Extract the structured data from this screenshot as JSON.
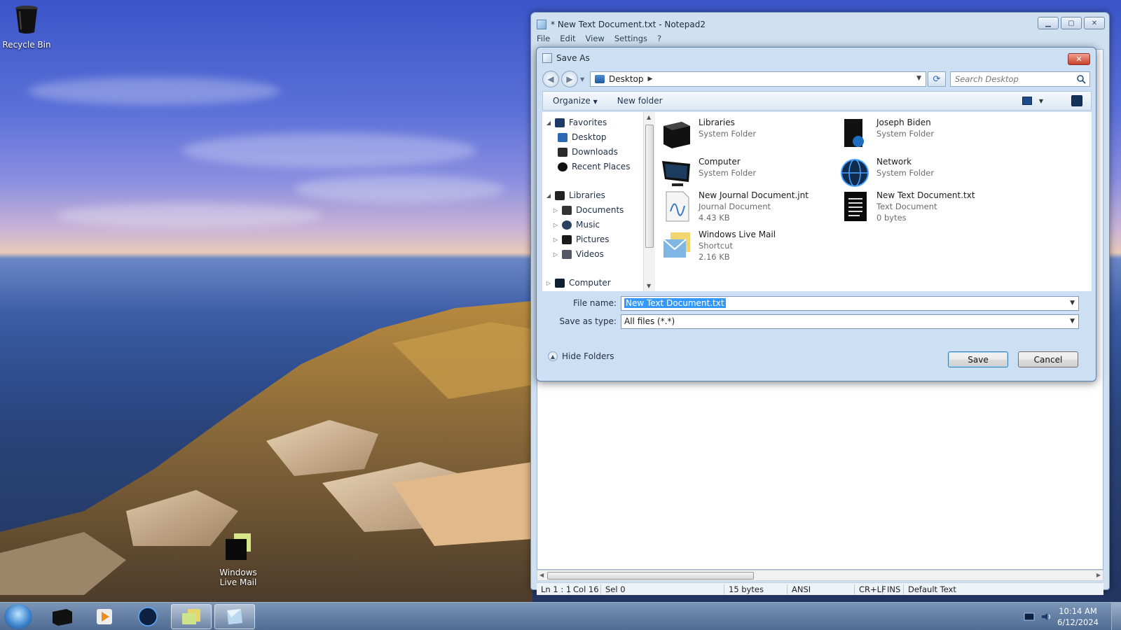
{
  "desktop": {
    "icons": [
      {
        "label": "Recycle Bin"
      },
      {
        "label": "Windows Live Mail"
      }
    ]
  },
  "notepad": {
    "title": "* New Text Document.txt - Notepad2",
    "menu": [
      "File",
      "Edit",
      "View",
      "Settings",
      "?"
    ],
    "status": {
      "position": "Ln 1 : 1",
      "column": "Col 16",
      "selection": "Sel 0",
      "size": "15 bytes",
      "encoding": "ANSI",
      "line_ending": "CR+LF",
      "mode": "INS",
      "scheme": "Default Text"
    }
  },
  "dialog": {
    "title": "Save As",
    "address": "Desktop",
    "search_placeholder": "Search Desktop",
    "toolbar": {
      "organize": "Organize",
      "new_folder": "New folder"
    },
    "tree": {
      "favorites": "Favorites",
      "desktop": "Desktop",
      "downloads": "Downloads",
      "recent": "Recent Places",
      "libraries": "Libraries",
      "documents": "Documents",
      "music": "Music",
      "pictures": "Pictures",
      "videos": "Videos",
      "computer": "Computer"
    },
    "files": [
      {
        "name": "Libraries",
        "type": "System Folder",
        "size": ""
      },
      {
        "name": "Joseph Biden",
        "type": "System Folder",
        "size": ""
      },
      {
        "name": "Computer",
        "type": "System Folder",
        "size": ""
      },
      {
        "name": "Network",
        "type": "System Folder",
        "size": ""
      },
      {
        "name": "New Journal Document.jnt",
        "type": "Journal Document",
        "size": "4.43 KB"
      },
      {
        "name": "New Text Document.txt",
        "type": "Text Document",
        "size": "0 bytes"
      },
      {
        "name": "Windows Live Mail",
        "type": "Shortcut",
        "size": "2.16 KB"
      }
    ],
    "file_name_label": "File name:",
    "file_name_value": "New Text Document.txt",
    "save_type_label": "Save as type:",
    "save_type_value": "All files (*.*)",
    "hide_folders": "Hide Folders",
    "save": "Save",
    "cancel": "Cancel"
  },
  "taskbar": {
    "time": "10:14 AM",
    "date": "6/12/2024"
  }
}
